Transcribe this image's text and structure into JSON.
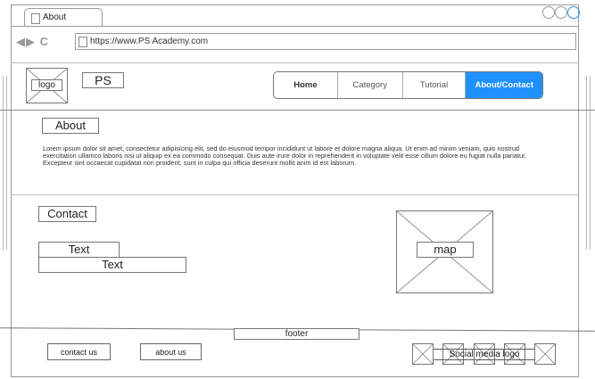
{
  "browser": {
    "tab_title": "About",
    "url": "https://www.PS Academy.com"
  },
  "header": {
    "logo_label": "logo",
    "brand": "PS",
    "nav": [
      "Home",
      "Category",
      "Tutorial",
      "About/Contact"
    ],
    "active_nav_index": 3,
    "active_color": "#1E90FF"
  },
  "about": {
    "heading": "About",
    "body": "Lorem ipsum dolor sit amet, consectetur adipisicing elit, sed do eiusmod tempor incididunt ut labore et dolore magna aliqua. Ut enim ad minim veniam, quis nostrud exercitation ullamco laboris nisi ut aliquip ex ea commodo consequat. Duis aute irure dolor in reprehenderit in voluptate velit esse cillum dolore eu fugiat nulla pariatur. Excepteur sint occaecat cupidatat non proident, sunt in culpa qui officia deserunt mollit anim id est laborum."
  },
  "contact": {
    "heading": "Contact",
    "text1": "Text",
    "text2": "Text",
    "map_label": "map"
  },
  "footer": {
    "label": "footer",
    "contact_us": "contact us",
    "about_us": "about us",
    "social_label": "Social media logo"
  }
}
